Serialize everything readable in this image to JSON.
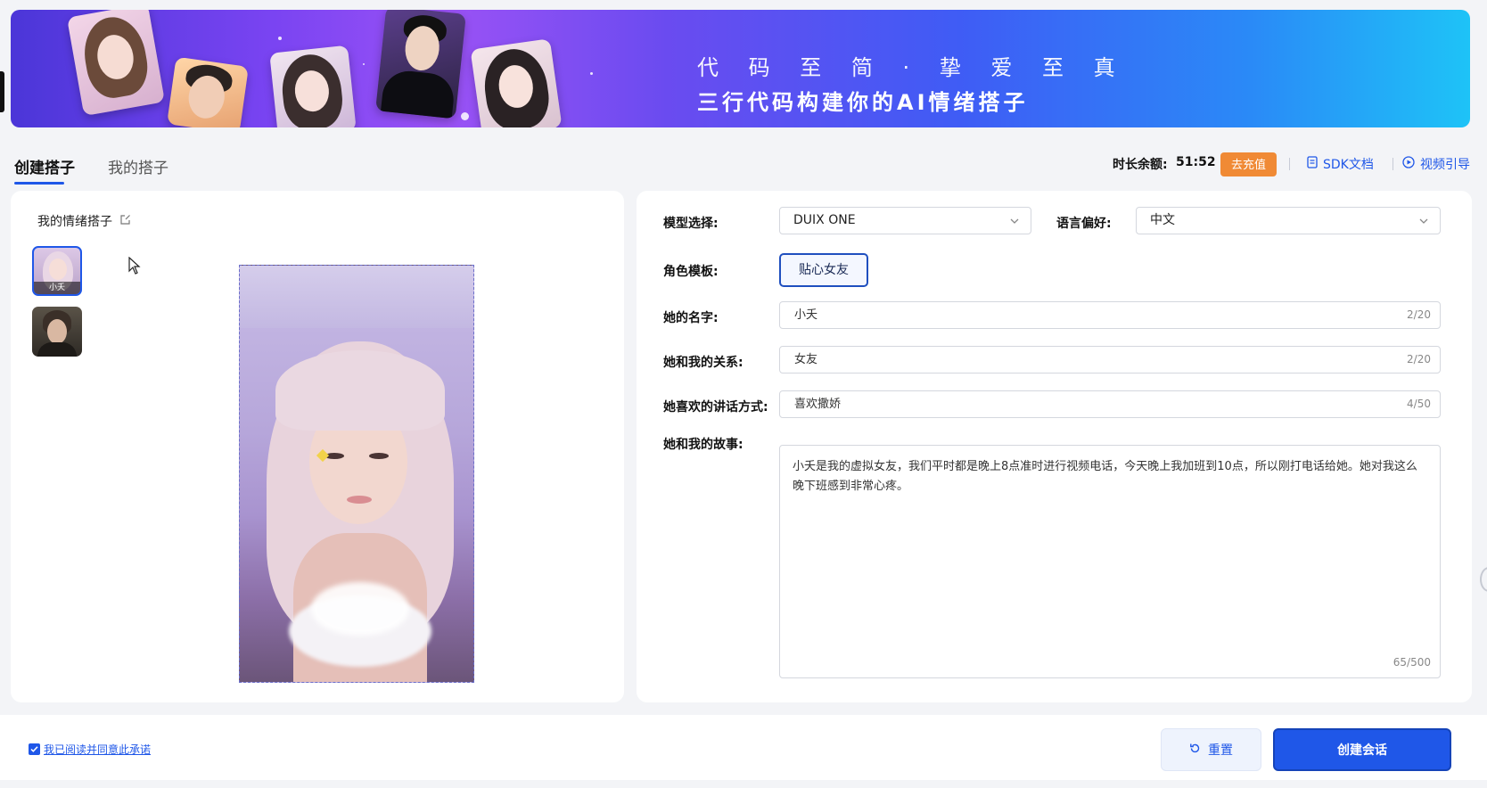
{
  "banner": {
    "line1": "代 码 至 简 · 挚 爱 至 真",
    "line2": "三行代码构建你的AI情绪搭子"
  },
  "tabs": [
    {
      "label": "创建搭子",
      "active": true
    },
    {
      "label": "我的搭子",
      "active": false
    }
  ],
  "account": {
    "balance_label": "时长余额:",
    "balance_value": "51:52",
    "recharge_label": "去充值",
    "sdk_label": "SDK文档",
    "video_label": "视频引导"
  },
  "left_panel": {
    "title": "我的情绪搭子",
    "avatars": [
      {
        "name": "小夭",
        "selected": true
      },
      {
        "name": "",
        "selected": false
      }
    ]
  },
  "form": {
    "model_label": "模型选择:",
    "model_value": "DUIX ONE",
    "language_label": "语言偏好:",
    "language_value": "中文",
    "role_label": "角色模板:",
    "role_value": "贴心女友",
    "name_label": "她的名字:",
    "name_value": "小夭",
    "name_count": "2/20",
    "relation_label": "她和我的关系:",
    "relation_value": "女友",
    "relation_count": "2/20",
    "style_label": "她喜欢的讲话方式:",
    "style_value": "喜欢撒娇",
    "style_count": "4/50",
    "story_label": "她和我的故事:",
    "story_value": "小夭是我的虚拟女友，我们平时都是晚上8点准时进行视频电话，今天晚上我加班到10点，所以刚打电话给她。她对我这么晚下班感到非常心疼。",
    "story_count": "65/500"
  },
  "footer": {
    "agree_label": "我已阅读并同意此承诺",
    "reset_label": "重置",
    "create_label": "创建会话"
  },
  "colors": {
    "accent": "#1f57e8",
    "recharge": "#f08a35"
  }
}
